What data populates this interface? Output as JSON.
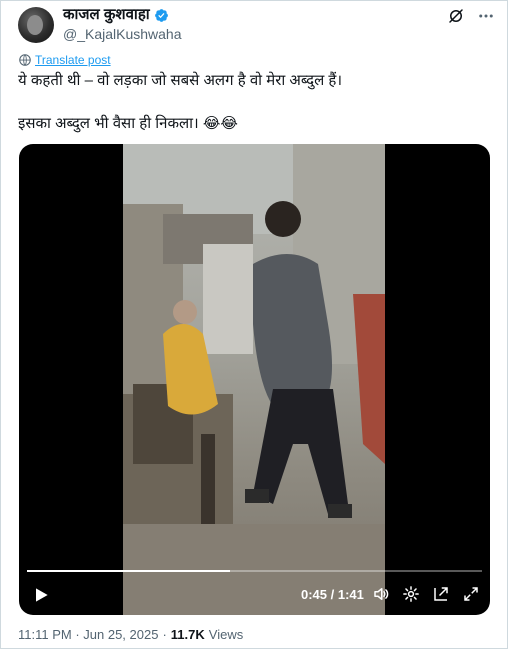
{
  "tweet": {
    "display_name": "काजल कुशवाहा",
    "handle": "@_KajalKushwaha",
    "translate_label": "Translate post",
    "text_line1": "ये कहती थी – वो लड़का जो सबसे अलग है वो मेरा अब्दुल हैं।",
    "text_line2": "इसका अब्दुल भी वैसा ही निकला। 😂😂",
    "timestamp": "11:11 PM · Jun 25, 2025",
    "dot": "·",
    "views_count": "11.7K",
    "views_label": "Views"
  },
  "video": {
    "current_time": "0:45",
    "separator": " / ",
    "duration": "1:41",
    "progress": 0.446
  },
  "icons": {
    "verified": "verified-badge-icon",
    "grok": "grok-icon",
    "more": "more-icon",
    "translate": "globe-icon",
    "play": "play-icon",
    "volume": "volume-icon",
    "settings": "gear-icon",
    "popout": "popout-icon",
    "fullscreen": "fullscreen-icon"
  },
  "colors": {
    "accent": "#1d9bf0",
    "text_primary": "#0f1419",
    "text_secondary": "#536471",
    "border": "#cfd9de"
  }
}
